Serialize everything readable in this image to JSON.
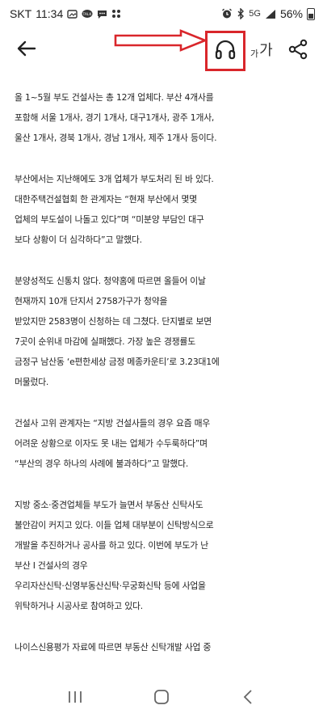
{
  "status_bar": {
    "carrier": "SKT",
    "time": "11:34",
    "left_icons": [
      "image-icon",
      "kakaotalk-icon",
      "chat-icon",
      "apps-icon"
    ],
    "right_icons": [
      "alarm-icon",
      "bluetooth-icon",
      "lte-icon",
      "signal-icon"
    ],
    "lte_label": "5G",
    "battery": "56%"
  },
  "app_bar": {
    "back_icon": "back-arrow-icon",
    "listen_icon": "headphones-icon",
    "font_size_small": "가",
    "font_size_large": "가",
    "share_icon": "share-icon",
    "annotation_color": "#d9262b"
  },
  "article": {
    "paragraphs": [
      {
        "lines": [
          "올 1~5월 부도 건설사는 총 12개 업체다. 부산 4개사를",
          "포함해 서울 1개사, 경기 1개사, 대구1개사, 광주 1개사,",
          "울산 1개사, 경북 1개사, 경남 1개사, 제주 1개사 등이다."
        ]
      },
      {
        "lines": [
          "부산에서는 지난해에도 3개 업체가 부도처리 된 바 있다.",
          "대한주택건설협회 한 관계자는 “현재 부산에서 몇몇",
          "업체의 부도설이 나돌고 있다”며 “미분양 부담인 대구",
          "보다 상황이 더 심각하다”고 말했다."
        ]
      },
      {
        "lines": [
          "분양성적도 신통치 않다. 청약홈에 따르면 올들어 이날",
          "현재까지 10개 단지서 2758가구가 청약을",
          "받았지만 2583명이 신청하는 데 그쳤다. 단지별로 보면",
          "7곳이 순위내 마감에 실패했다. 가장 높은 경쟁률도",
          "금정구 남산동 ‘e편한세상 금정 메종카운티’로 3.23대1에",
          "머물렀다."
        ]
      },
      {
        "lines": [
          "건설사 고위 관계자는 “지방 건설사들의 경우 요즘 매우",
          "어려운 상황으로 이자도 못 내는 업체가 수두룩하다”며",
          "“부산의 경우 하나의 사례에 불과하다”고 말했다."
        ]
      },
      {
        "lines": [
          "지방 중소·중견업체들 부도가 늘면서 부동산 신탁사도",
          "불안감이 커지고 있다. 이들 업체 대부분이 신탁방식으로",
          "개발을 추진하거나 공사를 하고 있다. 이번에 부도가 난",
          "부산 I 건설사의 경우",
          "우리자산신탁·신영부동산신탁·무궁화신탁 등에 사업을",
          "위탁하거나 시공사로 참여하고 있다."
        ]
      },
      {
        "lines": [
          "나이스신용평가 자료에 따르면 부동산 신탁개발 사업 중"
        ]
      }
    ]
  },
  "nav_bar": {
    "recents_icon": "recent-apps-icon",
    "home_icon": "home-icon",
    "back_icon": "nav-back-icon"
  }
}
